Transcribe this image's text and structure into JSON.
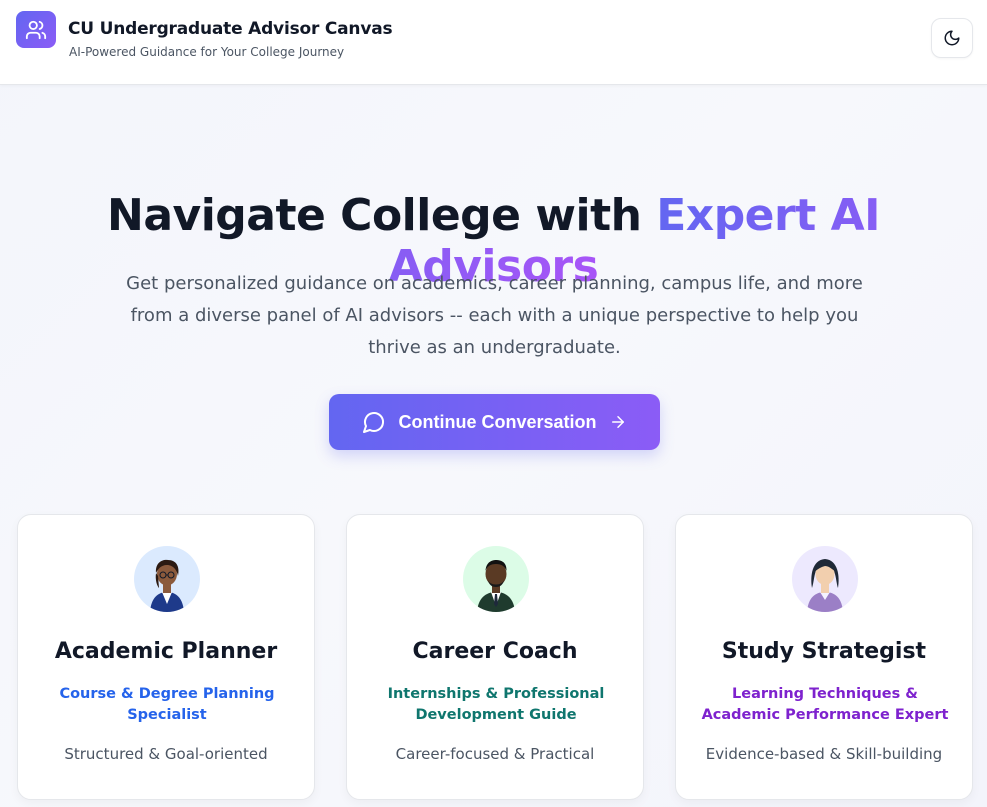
{
  "header": {
    "title": "CU Undergraduate Advisor Canvas",
    "subtitle": "AI-Powered Guidance for Your College Journey",
    "logo_icon": "users-icon",
    "theme_toggle_icon": "moon-icon"
  },
  "hero": {
    "title_main": "Navigate College with ",
    "title_accent": "Expert AI Advisors",
    "description": "Get personalized guidance on academics, career planning, campus life, and more from a diverse panel of AI advisors -- each with a unique perspective to help you thrive as an undergraduate.",
    "cta_label": "Continue Conversation",
    "cta_icon": "message-circle-icon",
    "cta_trailing_icon": "arrow-right-icon"
  },
  "advisors": [
    {
      "name": "Academic Planner",
      "role": "Course & Degree Planning Specialist",
      "style": "Structured & Goal-oriented",
      "role_color": "#2563eb",
      "avatar_bg": "#dbeafe"
    },
    {
      "name": "Career Coach",
      "role": "Internships & Professional Development Guide",
      "style": "Career-focused & Practical",
      "role_color": "#0f766e",
      "avatar_bg": "#dcfce7"
    },
    {
      "name": "Study Strategist",
      "role": "Learning Techniques & Academic Performance Expert",
      "style": "Evidence-based & Skill-building",
      "role_color": "#7e22ce",
      "avatar_bg": "#ede9fe"
    }
  ],
  "colors": {
    "accent_start": "#6366f1",
    "accent_end": "#a855f7"
  }
}
